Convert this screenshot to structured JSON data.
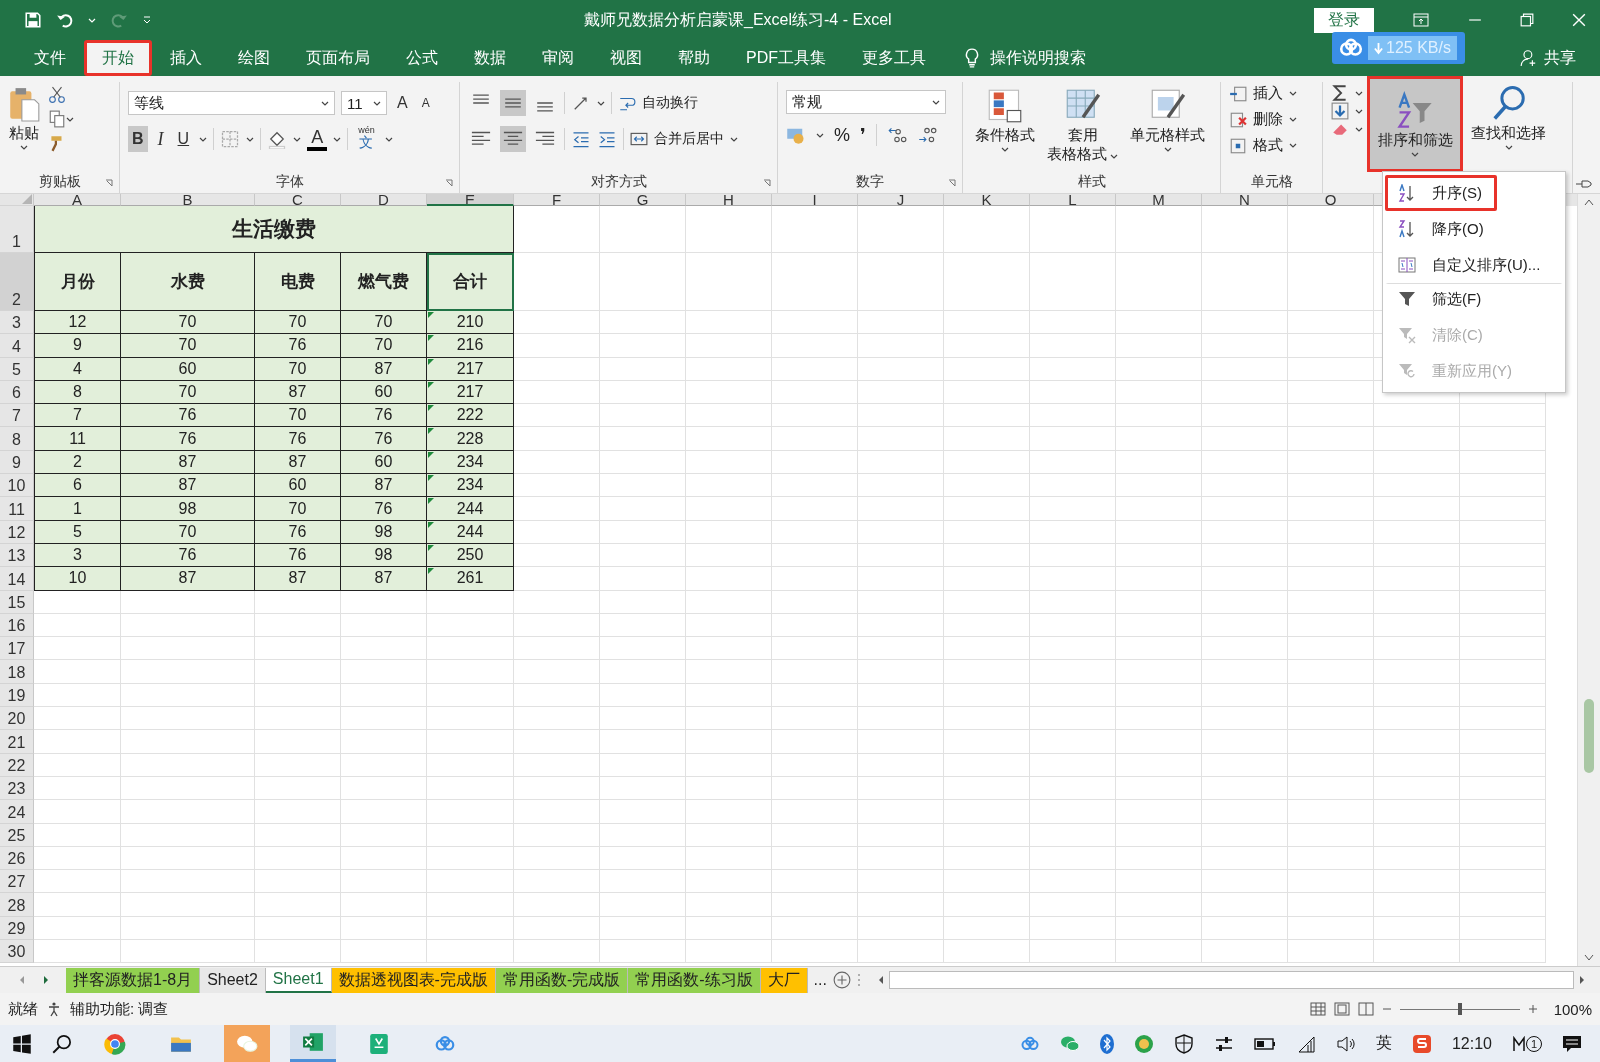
{
  "title_bar": {
    "title": "戴师兄数据分析启蒙课_Excel练习-4  -  Excel",
    "login": "登录"
  },
  "menu_tabs": [
    {
      "label": "文件",
      "selected": false,
      "outlined": false
    },
    {
      "label": "开始",
      "selected": true,
      "outlined": true
    },
    {
      "label": "插入",
      "selected": false,
      "outlined": false
    },
    {
      "label": "绘图",
      "selected": false,
      "outlined": false
    },
    {
      "label": "页面布局",
      "selected": false,
      "outlined": false
    },
    {
      "label": "公式",
      "selected": false,
      "outlined": false
    },
    {
      "label": "数据",
      "selected": false,
      "outlined": false
    },
    {
      "label": "审阅",
      "selected": false,
      "outlined": false
    },
    {
      "label": "视图",
      "selected": false,
      "outlined": false
    },
    {
      "label": "帮助",
      "selected": false,
      "outlined": false
    },
    {
      "label": "PDF工具集",
      "selected": false,
      "outlined": false
    },
    {
      "label": "更多工具",
      "selected": false,
      "outlined": false
    }
  ],
  "tell_me": "操作说明搜索",
  "cloud_badge": {
    "speed": "125 KB/s"
  },
  "share": "共享",
  "ribbon": {
    "clipboard": {
      "label": "剪贴板",
      "paste": "粘贴"
    },
    "font": {
      "label": "字体",
      "font_name": "等线",
      "font_size": "11",
      "grow": "A",
      "shrink": "A",
      "bold": "B",
      "italic": "I",
      "underline": "U",
      "color_letter": "A",
      "phonetic_ruby": "wén",
      "phonetic_base": "文"
    },
    "alignment": {
      "label": "对齐方式",
      "vertical": [
        {
          "selected": false
        },
        {
          "selected": true
        },
        {
          "selected": false
        }
      ],
      "horizontal": [
        {
          "selected": false
        },
        {
          "selected": true
        },
        {
          "selected": false
        }
      ],
      "wrap": "自动换行",
      "merge": "合并后居中"
    },
    "number": {
      "label": "数字",
      "format": "常规",
      "percent": "%",
      "comma": "❜"
    },
    "styles": {
      "label": "样式",
      "buttons": [
        {
          "kind": "conditional",
          "lines": [
            "条件格式"
          ]
        },
        {
          "kind": "table",
          "lines": [
            "套用",
            "表格格式"
          ]
        },
        {
          "kind": "cell",
          "lines": [
            "单元格样式"
          ]
        }
      ]
    },
    "cells": {
      "label": "单元格",
      "items": [
        {
          "kind": "insert",
          "label": "插入"
        },
        {
          "kind": "delete",
          "label": "删除"
        },
        {
          "kind": "format",
          "label": "格式"
        }
      ]
    },
    "editing": {
      "sort_filter": {
        "label": "排序和筛选",
        "pressed": true,
        "outlined": true
      },
      "find": "查找和选择"
    }
  },
  "sort_menu": [
    {
      "kind": "asc",
      "label": "升序(S)",
      "disabled": false,
      "outlined": true,
      "separator_before": false
    },
    {
      "kind": "desc",
      "label": "降序(O)",
      "disabled": false,
      "outlined": false,
      "separator_before": false
    },
    {
      "kind": "custom",
      "label": "自定义排序(U)...",
      "disabled": false,
      "outlined": false,
      "separator_before": false
    },
    {
      "kind": "filter",
      "label": "筛选(F)",
      "disabled": false,
      "outlined": false,
      "separator_before": true
    },
    {
      "kind": "clear",
      "label": "清除(C)",
      "disabled": true,
      "outlined": false,
      "separator_before": false
    },
    {
      "kind": "reapply",
      "label": "重新应用(Y)",
      "disabled": true,
      "outlined": false,
      "separator_before": false
    }
  ],
  "sheet": {
    "columns": [
      "A",
      "B",
      "C",
      "D",
      "E",
      "F",
      "G",
      "H",
      "I",
      "J",
      "K",
      "L",
      "M",
      "N",
      "O"
    ],
    "row_numbers": [
      "1",
      "2",
      "3",
      "4",
      "5",
      "6",
      "7",
      "8",
      "9",
      "10",
      "11",
      "12",
      "13",
      "14",
      "15",
      "16",
      "17",
      "18",
      "19",
      "20",
      "21",
      "22",
      "23",
      "24",
      "25",
      "26",
      "27",
      "28",
      "29",
      "30"
    ],
    "table": {
      "title": "生活缴费",
      "headers": [
        {
          "text": "月份",
          "selected": false
        },
        {
          "text": "水费",
          "selected": false
        },
        {
          "text": "电费",
          "selected": false
        },
        {
          "text": "燃气费",
          "selected": false
        },
        {
          "text": "合计",
          "selected": true
        }
      ],
      "rows": [
        {
          "cells": [
            "12",
            "70",
            "70",
            "70",
            "210"
          ],
          "flagged": true
        },
        {
          "cells": [
            "9",
            "70",
            "76",
            "70",
            "216"
          ],
          "flagged": true
        },
        {
          "cells": [
            "4",
            "60",
            "70",
            "87",
            "217"
          ],
          "flagged": true
        },
        {
          "cells": [
            "8",
            "70",
            "87",
            "60",
            "217"
          ],
          "flagged": true
        },
        {
          "cells": [
            "7",
            "76",
            "70",
            "76",
            "222"
          ],
          "flagged": true
        },
        {
          "cells": [
            "11",
            "76",
            "76",
            "76",
            "228"
          ],
          "flagged": true
        },
        {
          "cells": [
            "2",
            "87",
            "87",
            "60",
            "234"
          ],
          "flagged": true
        },
        {
          "cells": [
            "6",
            "87",
            "60",
            "87",
            "234"
          ],
          "flagged": true
        },
        {
          "cells": [
            "1",
            "98",
            "70",
            "76",
            "244"
          ],
          "flagged": true
        },
        {
          "cells": [
            "5",
            "70",
            "76",
            "98",
            "244"
          ],
          "flagged": true
        },
        {
          "cells": [
            "3",
            "76",
            "76",
            "98",
            "250"
          ],
          "flagged": true
        },
        {
          "cells": [
            "10",
            "87",
            "87",
            "87",
            "261"
          ],
          "flagged": true
        }
      ]
    }
  },
  "sheet_tabs": [
    {
      "label": "拌客源数据1-8月",
      "color": "#92d050",
      "selected": false
    },
    {
      "label": "Sheet2",
      "selected": false
    },
    {
      "label": "Sheet1",
      "selected": true
    },
    {
      "label": "数据透视图表-完成版",
      "color": "#ffc000",
      "selected": false
    },
    {
      "label": "常用函数-完成版",
      "color": "#92d050",
      "selected": false
    },
    {
      "label": "常用函数-练习版",
      "color": "#92d050",
      "selected": false
    },
    {
      "label": "大厂",
      "color": "#ffc000",
      "selected": false
    }
  ],
  "more_tabs": "...",
  "status_bar": {
    "ready": "就绪",
    "accessibility": "辅助功能: 调查",
    "zoom_slider": {
      "level": 0.5
    },
    "zoom": "100%"
  },
  "taskbar": {
    "apps": [
      {
        "kind": "browser",
        "flashing": false,
        "active": false
      },
      {
        "kind": "folder",
        "flashing": false,
        "active": false
      },
      {
        "kind": "chat",
        "flashing": true,
        "active": false
      },
      {
        "kind": "excel",
        "flashing": false,
        "active": true
      },
      {
        "kind": "pdf",
        "flashing": false,
        "active": false
      },
      {
        "kind": "cloud",
        "flashing": false,
        "active": false
      }
    ],
    "ime": "英",
    "time": "12:10",
    "notifications": "1"
  }
}
